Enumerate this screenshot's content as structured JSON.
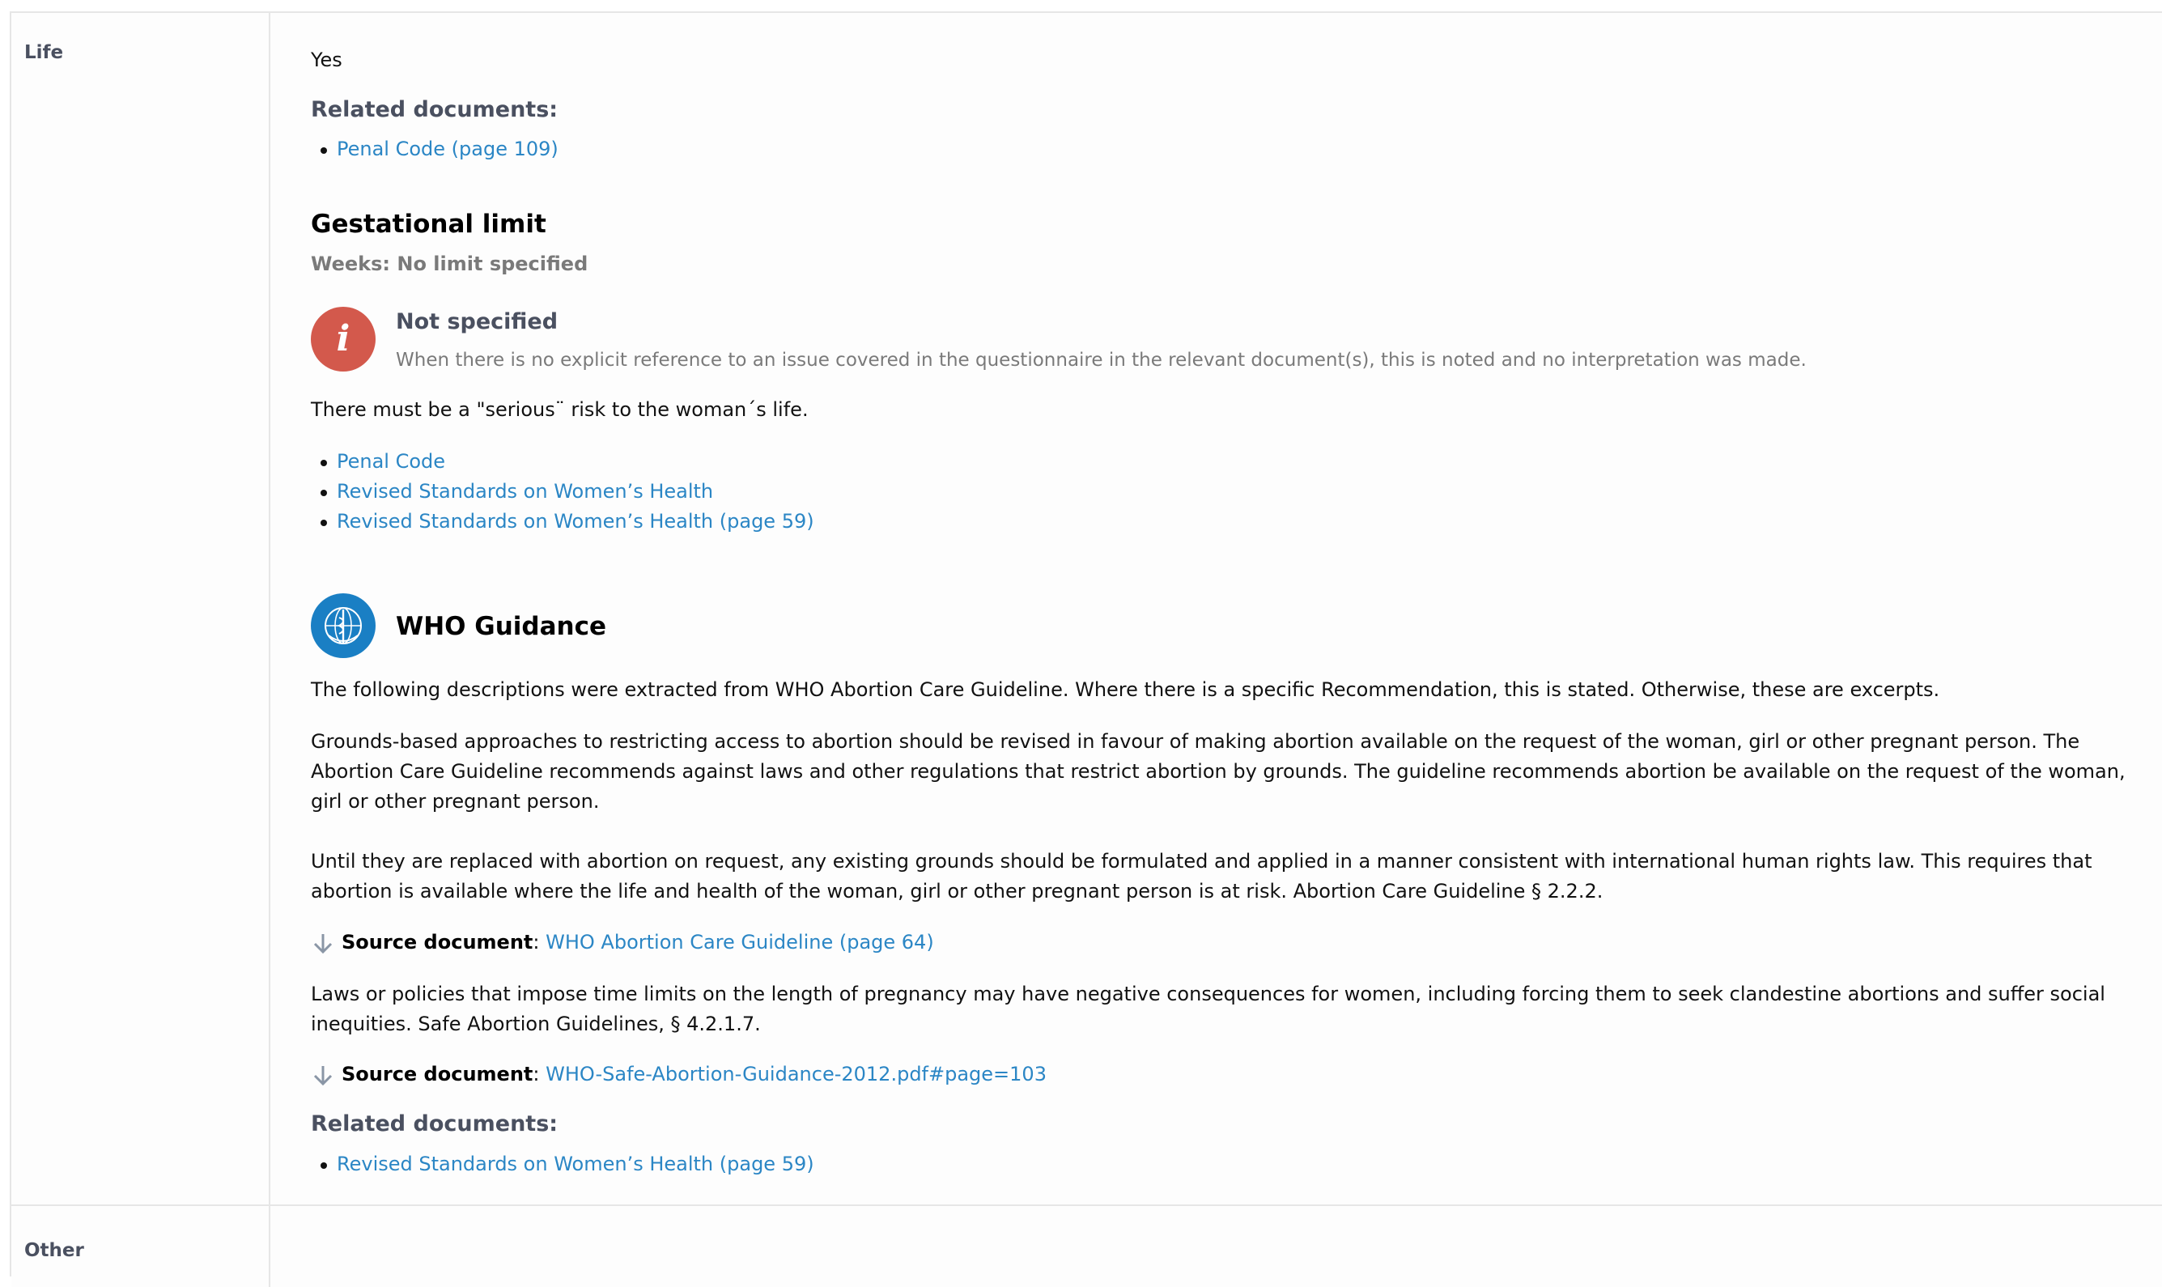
{
  "rows": {
    "life": {
      "label": "Life",
      "answer": "Yes",
      "related_heading": "Related documents:",
      "related_links": [
        "Penal Code (page 109)"
      ],
      "gestational": {
        "heading": "Gestational limit",
        "weeks": "Weeks: No limit specified",
        "notice_title": "Not specified",
        "notice_text": "When there is no explicit reference to an issue covered in the questionnaire in the relevant document(s), this is noted and no interpretation was made.",
        "note": "There must be a \"serious¨ risk to the woman´s life.",
        "links": [
          "Penal Code",
          "Revised Standards on Women’s Health",
          "Revised Standards on Women’s Health (page 59)"
        ]
      },
      "who": {
        "heading": "WHO Guidance",
        "intro": "The following descriptions were extracted from WHO Abortion Care Guideline. Where there is a specific Recommendation, this is stated. Otherwise, these are excerpts.",
        "para1": "Grounds-based approaches to restricting access to abortion should be revised in favour of making abortion available on the request of the woman, girl or other pregnant person. The Abortion Care Guideline recommends against laws and other regulations that restrict abortion by grounds. The guideline recommends abortion be available on the request of the woman, girl or other pregnant person.",
        "para2": "Until they are replaced with abortion on request, any existing grounds should be formulated and applied in a manner consistent with international human rights law. This requires that abortion is available where the life and health of the woman, girl or other pregnant person is at risk. Abortion Care Guideline § 2.2.2.",
        "source_label": "Source document",
        "source_sep": ":",
        "source1_link": "WHO Abortion Care Guideline (page 64)",
        "para3": "Laws or policies that impose time limits on the length of pregnancy may have negative consequences for women, including forcing them to seek clandestine abortions and suffer social inequities. Safe Abortion Guidelines, § 4.2.1.7.",
        "source2_link": "WHO-Safe-Abortion-Guidance-2012.pdf#page=103",
        "related_heading": "Related documents:",
        "related_links": [
          "Revised Standards on Women’s Health (page 59)"
        ]
      }
    },
    "other": {
      "label": "Other"
    }
  },
  "colors": {
    "link": "#2b86c5",
    "info_icon": "#d3594c",
    "who_icon": "#1a7fc4",
    "subheading": "#4a5060"
  },
  "icons": {
    "info": "info-icon",
    "who": "who-emblem-icon",
    "source": "download-arrow-icon"
  }
}
